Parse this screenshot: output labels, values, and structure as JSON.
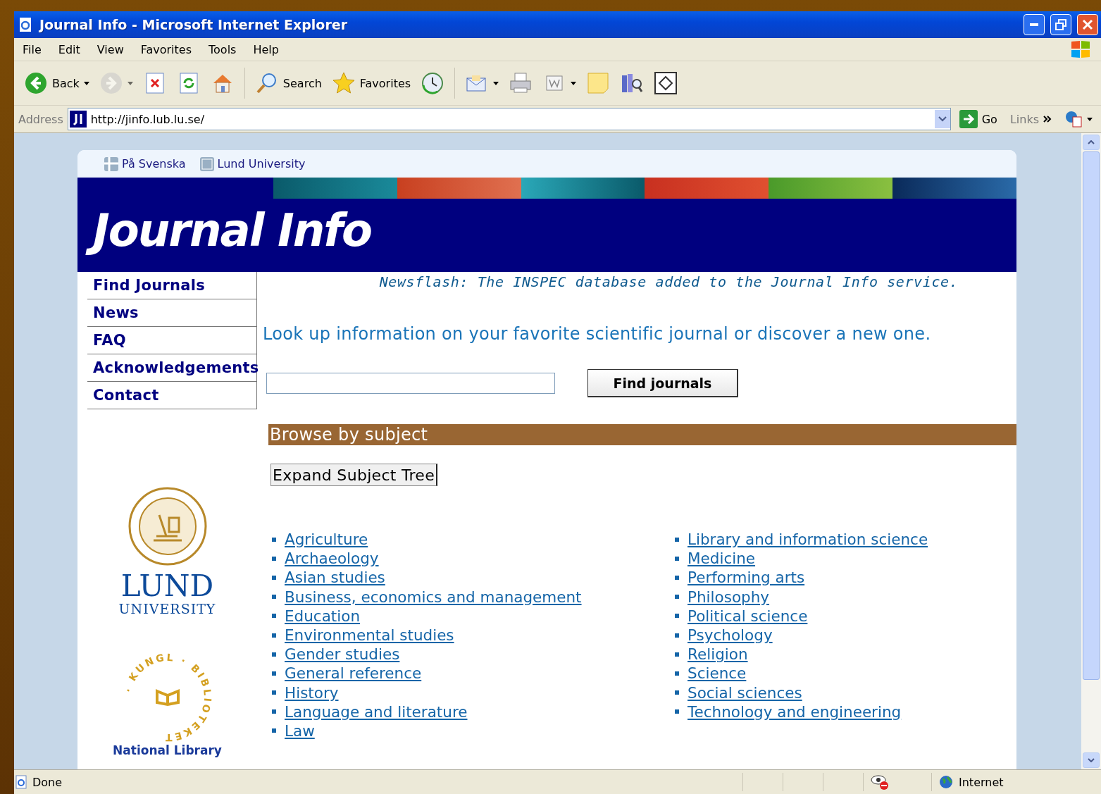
{
  "window": {
    "title": "Journal Info - Microsoft Internet Explorer"
  },
  "menu": [
    "File",
    "Edit",
    "View",
    "Favorites",
    "Tools",
    "Help"
  ],
  "toolbar": [
    {
      "kind": "back",
      "label": "Back",
      "has_menu": true,
      "disabled": false
    },
    {
      "kind": "forward",
      "has_menu": true,
      "disabled": true
    },
    {
      "kind": "stop",
      "has_menu": false,
      "disabled": false
    },
    {
      "kind": "refresh",
      "has_menu": false,
      "disabled": false
    },
    {
      "kind": "home",
      "has_menu": false,
      "disabled": false
    },
    {
      "kind": "search",
      "label": "Search",
      "has_menu": false,
      "disabled": false
    },
    {
      "kind": "favorites",
      "label": "Favorites",
      "has_menu": false,
      "disabled": false
    },
    {
      "kind": "history",
      "has_menu": false,
      "disabled": false
    },
    {
      "kind": "mail",
      "has_menu": true,
      "disabled": false
    },
    {
      "kind": "print",
      "has_menu": false,
      "disabled": false
    },
    {
      "kind": "edit",
      "has_menu": true,
      "disabled": false
    },
    {
      "kind": "note",
      "has_menu": false,
      "disabled": false
    },
    {
      "kind": "research",
      "has_menu": false,
      "disabled": false
    },
    {
      "kind": "frame",
      "has_menu": false,
      "disabled": false
    }
  ],
  "address": {
    "label": "Address",
    "value": "http://jinfo.lub.lu.se/",
    "go": "Go",
    "links": "Links"
  },
  "page": {
    "top_links": [
      {
        "kind": "flag",
        "label": "På Svenska"
      },
      {
        "kind": "lu",
        "label": "Lund University"
      }
    ],
    "banner_title": "Journal Info",
    "nav": [
      "Find Journals",
      "News",
      "FAQ",
      "Acknowledgements",
      "Contact"
    ],
    "newsflash": "Newsflash: The INSPEC database added to the Journal Info service.",
    "intro": "Look up information on your favorite scientific journal or discover a new one.",
    "search_button": "Find journals",
    "browse_title": "Browse by subject",
    "expand_button": "Expand Subject Tree",
    "subjects_left": [
      "Agriculture",
      "Archaeology",
      "Asian studies",
      "Business, economics and management",
      "Education",
      "Environmental studies",
      "Gender studies",
      "General reference",
      "History",
      "Language and literature",
      "Law"
    ],
    "subjects_right": [
      "Library and information science",
      "Medicine",
      "Performing arts",
      "Philosophy",
      "Political science",
      "Psychology",
      "Religion",
      "Science",
      "Social sciences",
      "Technology and engineering"
    ],
    "lund_logo": {
      "name": "LUND",
      "subtitle": "UNIVERSITY"
    },
    "kb_logo": {
      "ring": "· KUNGL · BIBLIOTEKET",
      "caption": "National Library"
    }
  },
  "status": {
    "text": "Done",
    "zone": "Internet"
  }
}
